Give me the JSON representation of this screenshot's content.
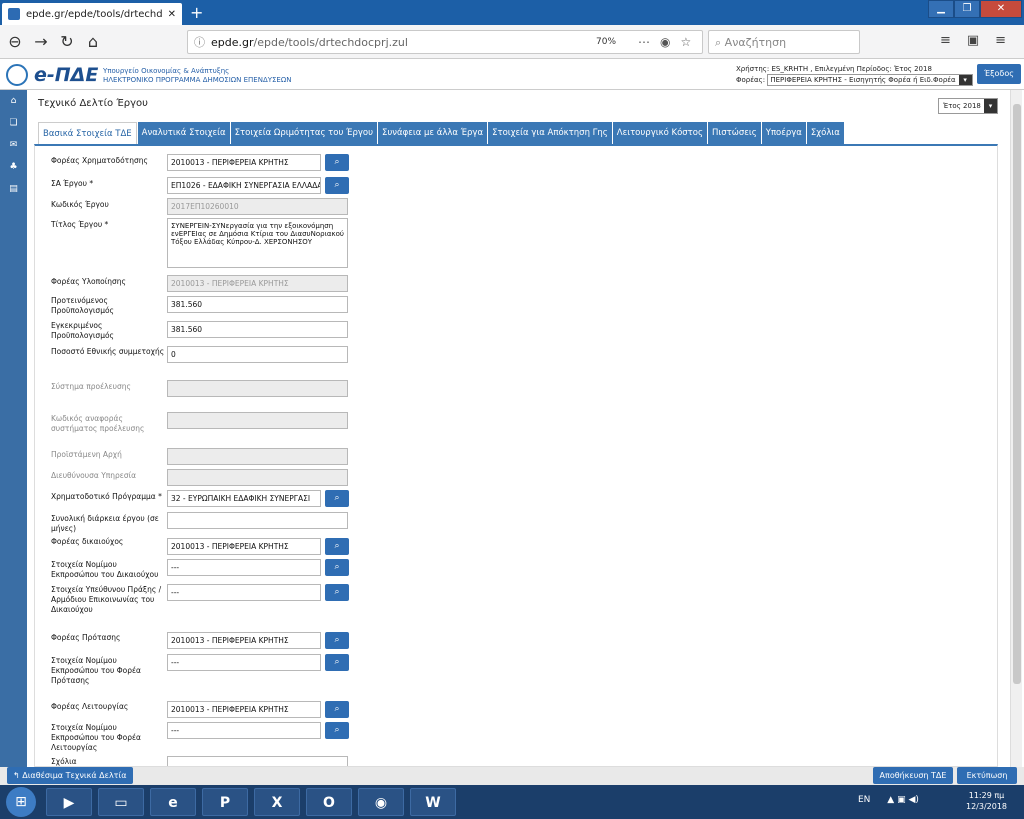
{
  "browser": {
    "tab_title": "epde.gr/epde/tools/drtechdoc",
    "new_tab": "+",
    "url_domain": "epde.gr",
    "url_path": "/epde/tools/drtechdocprj.zul",
    "zoom": "70%",
    "search_placeholder": "Αναζήτηση"
  },
  "app": {
    "brand": "e-ΠΔΕ",
    "ministry_line1": "Υπουργείο Οικονομίας & Ανάπτυξης",
    "ministry_line2": "ΗΛΕΚΤΡΟΝΙΚΟ ΠΡΟΓΡΑΜΜΑ ΔΗΜΟΣΙΩΝ ΕΠΕΝΔΥΣΕΩΝ",
    "user_line": "Χρήστης: ES_KRHTH , Επιλεγμένη Περίοδος: Έτος 2018",
    "forea_label": "Φορέας:",
    "forea_value": "ΠΕΡΙΦΕΡΕΙΑ ΚΡΗΤΗΣ - Εισηγητής Φορέα ή Ειδ.Φορέα",
    "exit_label": "Έξοδος"
  },
  "page": {
    "title": "Τεχνικό Δελτίο Έργου",
    "year_value": "Έτος 2018"
  },
  "tabs": [
    "Βασικά Στοιχεία ΤΔΕ",
    "Αναλυτικά Στοιχεία",
    "Στοιχεία Ωριμότητας του Έργου",
    "Συνάφεια με άλλα Έργα",
    "Στοιχεία για Απόκτηση Γης",
    "Λειτουργικό Κόστος",
    "Πιστώσεις",
    "Υποέργα",
    "Σχόλια"
  ],
  "form": {
    "foreas_xrim": {
      "label": "Φορέας Χρηματοδότησης",
      "value": "2010013 - ΠΕΡΙΦΕΡΕΙΑ ΚΡΗΤΗΣ"
    },
    "sa_ergou": {
      "label": "ΣΑ Έργου *",
      "value": "ΕΠ1026 - ΕΔΑΦΙΚΗ ΣΥΝΕΡΓΑΣΙΑ ΕΛΛΑΔΑ"
    },
    "kodikos": {
      "label": "Κωδικός Έργου",
      "value": "2017ΕΠ10260010"
    },
    "titlos": {
      "label": "Τίτλος Έργου *",
      "value": "ΣΥΝΕΡΓΕΙΝ-ΣΥΝεργασία για την εξοικονόμηση ενΕΡΓΕΙας σε Δημόσια Κτίρια του ΔιασυΝοριακού Τόξου Ελλάδας Κύπρου-Δ. ΧΕΡΣΟΝΗΣΟΥ"
    },
    "foreas_ylop": {
      "label": "Φορέας Υλοποίησης",
      "value": "2010013 - ΠΕΡΙΦΕΡΕΙΑ ΚΡΗΤΗΣ"
    },
    "proteinomenos": {
      "label1": "Προτεινόμενος",
      "label2": "Προϋπολογισμός",
      "value": "381.560"
    },
    "egkekrimenos": {
      "label1": "Εγκεκριμένος",
      "label2": "Προϋπολογισμός",
      "value": "381.560"
    },
    "pososto": {
      "label": "Ποσοστό Εθνικής συμμετοχής",
      "value": "0"
    },
    "systima": {
      "label": "Σύστημα προέλευσης",
      "value": ""
    },
    "kodikos_anaf": {
      "label1": "Κωδικός αναφοράς",
      "label2": "συστήματος προέλευσης",
      "value": ""
    },
    "proistamenh": {
      "label": "Προϊστάμενη Αρχή",
      "value": ""
    },
    "dieuthynousa": {
      "label": "Διευθύνουσα Υπηρεσία",
      "value": ""
    },
    "xrim_programma": {
      "label": "Χρηματοδοτικό Πρόγραμμα *",
      "value": "32 - ΕΥΡΩΠΑΙΚΗ ΕΔΑΦΙΚΗ ΣΥΝΕΡΓΑΣΙ"
    },
    "diarkeia": {
      "label1": "Συνολική διάρκεια έργου (σε",
      "label2": "μήνες)",
      "value": ""
    },
    "foreas_dikaiouxos": {
      "label": "Φορέας δικαιούχος",
      "value": "2010013 - ΠΕΡΙΦΕΡΕΙΑ ΚΡΗΤΗΣ"
    },
    "nomimos_dik": {
      "label1": "Στοιχεία Νομίμου",
      "label2": "Εκπροσώπου του Δικαιούχου",
      "value": "---"
    },
    "ypeuthynos": {
      "label1": "Στοιχεία Υπεύθυνου Πράξης /",
      "label2": "Αρμόδιου Επικοινωνίας του",
      "label3": "Δικαιούχου",
      "value": "---"
    },
    "foreas_protasis": {
      "label": "Φορέας Πρότασης",
      "value": "2010013 - ΠΕΡΙΦΕΡΕΙΑ ΚΡΗΤΗΣ"
    },
    "nomimos_prot": {
      "label1": "Στοιχεία Νομίμου",
      "label2": "Εκπροσώπου του Φορέα",
      "label3": "Πρότασης",
      "value": "---"
    },
    "foreas_leit": {
      "label": "Φορέας Λειτουργίας",
      "value": "2010013 - ΠΕΡΙΦΕΡΕΙΑ ΚΡΗΤΗΣ"
    },
    "nomimos_leit": {
      "label1": "Στοιχεία Νομίμου",
      "label2": "Εκπροσώπου του Φορέα",
      "label3": "Λειτουργίας",
      "value": "---"
    },
    "sxolia": {
      "label": "Σχόλια",
      "value": ""
    }
  },
  "footer": {
    "back_label": "Διαθέσιμα Τεχνικά Δελτία",
    "save_label": "Αποθήκευση ΤΔΕ",
    "print_label": "Εκτύπωση"
  },
  "taskbar": {
    "lang": "EN",
    "time": "11:29 πμ",
    "date": "12/3/2018"
  }
}
